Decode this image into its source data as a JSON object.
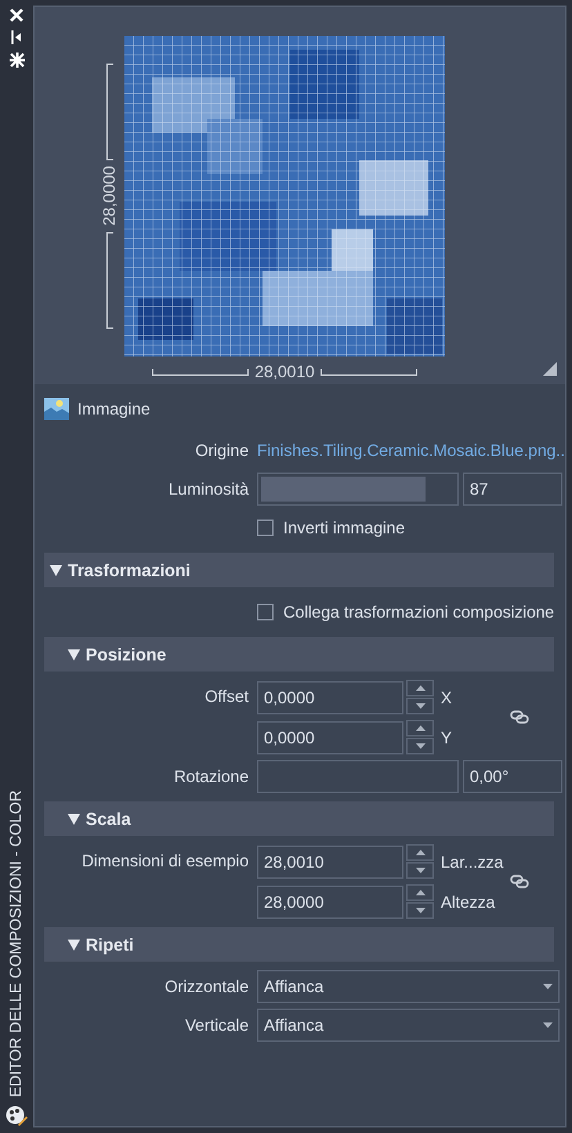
{
  "sidebar": {
    "title": "EDITOR DELLE COMPOSIZIONI - COLOR"
  },
  "preview": {
    "kind": "picture",
    "width_label": "28,0010",
    "height_label": "28,0000"
  },
  "image_section": {
    "title": "Immagine",
    "source_label": "Origine",
    "source": "Finishes.Tiling.Ceramic.Mosaic.Blue.png...",
    "brightness": {
      "label": "Luminosità",
      "level": 0.85,
      "value": "87"
    },
    "invert": {
      "label": "Inverti immagine",
      "checked": false
    }
  },
  "transformations": {
    "title": "Trasformazioni",
    "expanded": true,
    "link_option": {
      "label": "Collega trasformazioni composizione",
      "checked": false
    },
    "subsections": [
      {
        "title": "Posizione",
        "expanded": true,
        "rows": [
          {
            "kind": "spinners",
            "label": "Offset",
            "linked": true,
            "fields": [
              {
                "value": "0,0000",
                "suffix": "X"
              },
              {
                "value": "0,0000",
                "suffix": "Y"
              }
            ]
          },
          {
            "kind": "angle",
            "label": "Rotazione",
            "value": "0,00°"
          }
        ]
      },
      {
        "title": "Scala",
        "expanded": true,
        "rows": [
          {
            "kind": "spinners",
            "label": "Dimensioni di esempio",
            "linked": true,
            "fields": [
              {
                "value": "28,0010",
                "suffix": "Lar...zza"
              },
              {
                "value": "28,0000",
                "suffix": "Altezza"
              }
            ]
          }
        ]
      },
      {
        "title": "Ripeti",
        "expanded": true,
        "rows": [
          {
            "kind": "dropdown",
            "label": "Orizzontale",
            "value": "Affianca"
          },
          {
            "kind": "dropdown",
            "label": "Verticale",
            "value": "Affianca"
          }
        ]
      }
    ]
  }
}
